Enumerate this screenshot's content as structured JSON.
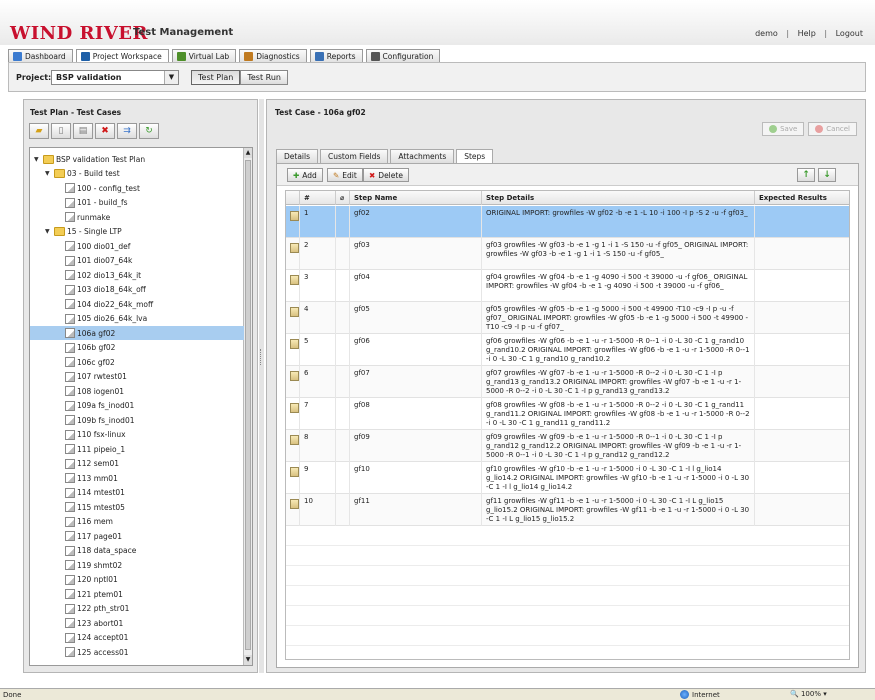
{
  "header": {
    "logo": "WIND RIVER",
    "app_title": "Test Management",
    "user": "demo",
    "help": "Help",
    "logout": "Logout"
  },
  "nav_tabs": [
    {
      "label": "Dashboard",
      "icon": "dashboard-icon",
      "color": "#3b7bd0"
    },
    {
      "label": "Project Workspace",
      "icon": "workspace-icon",
      "color": "#1d5fa8"
    },
    {
      "label": "Virtual Lab",
      "icon": "virtual-lab-icon",
      "color": "#4e8f2a"
    },
    {
      "label": "Diagnostics",
      "icon": "diagnostics-icon",
      "color": "#c07a20"
    },
    {
      "label": "Reports",
      "icon": "reports-icon",
      "color": "#3970b5"
    },
    {
      "label": "Configuration",
      "icon": "configuration-icon",
      "color": "#555555"
    }
  ],
  "project": {
    "label": "Project:",
    "selected": "BSP validation",
    "views": [
      "Test Plan",
      "Test Run"
    ]
  },
  "left_panel": {
    "title": "Test Plan - Test Cases",
    "tree": [
      {
        "label": "BSP validation Test Plan",
        "type": "folder",
        "level": 0,
        "open": true
      },
      {
        "label": "03 - Build test",
        "type": "folder",
        "level": 1,
        "open": true
      },
      {
        "label": "100 - config_test",
        "type": "doc",
        "level": 2
      },
      {
        "label": "101 - build_fs",
        "type": "doc",
        "level": 2
      },
      {
        "label": "runmake",
        "type": "doc",
        "level": 2
      },
      {
        "label": "15 - Single LTP",
        "type": "folder",
        "level": 1,
        "open": true
      },
      {
        "label": "100 dio01_def",
        "type": "doc",
        "level": 2
      },
      {
        "label": "101 dio07_64k",
        "type": "doc",
        "level": 2
      },
      {
        "label": "102 dio13_64k_it",
        "type": "doc",
        "level": 2
      },
      {
        "label": "103 dio18_64k_off",
        "type": "doc",
        "level": 2
      },
      {
        "label": "104 dio22_64k_moff",
        "type": "doc",
        "level": 2
      },
      {
        "label": "105 dio26_64k_lva",
        "type": "doc",
        "level": 2
      },
      {
        "label": "106a gf02",
        "type": "doc",
        "level": 2,
        "selected": true
      },
      {
        "label": "106b gf02",
        "type": "doc",
        "level": 2
      },
      {
        "label": "106c gf02",
        "type": "doc",
        "level": 2
      },
      {
        "label": "107 rwtest01",
        "type": "doc",
        "level": 2
      },
      {
        "label": "108 iogen01",
        "type": "doc",
        "level": 2
      },
      {
        "label": "109a fs_inod01",
        "type": "doc",
        "level": 2
      },
      {
        "label": "109b fs_inod01",
        "type": "doc",
        "level": 2
      },
      {
        "label": "110 fsx-linux",
        "type": "doc",
        "level": 2
      },
      {
        "label": "111 pipeio_1",
        "type": "doc",
        "level": 2
      },
      {
        "label": "112 sem01",
        "type": "doc",
        "level": 2
      },
      {
        "label": "113 mm01",
        "type": "doc",
        "level": 2
      },
      {
        "label": "114 mtest01",
        "type": "doc",
        "level": 2
      },
      {
        "label": "115 mtest05",
        "type": "doc",
        "level": 2
      },
      {
        "label": "116 mem",
        "type": "doc",
        "level": 2
      },
      {
        "label": "117 page01",
        "type": "doc",
        "level": 2
      },
      {
        "label": "118 data_space",
        "type": "doc",
        "level": 2
      },
      {
        "label": "119 shmt02",
        "type": "doc",
        "level": 2
      },
      {
        "label": "120 nptl01",
        "type": "doc",
        "level": 2
      },
      {
        "label": "121 ptem01",
        "type": "doc",
        "level": 2
      },
      {
        "label": "122 pth_str01",
        "type": "doc",
        "level": 2
      },
      {
        "label": "123 abort01",
        "type": "doc",
        "level": 2
      },
      {
        "label": "124 accept01",
        "type": "doc",
        "level": 2
      },
      {
        "label": "125 access01",
        "type": "doc",
        "level": 2
      }
    ]
  },
  "right_panel": {
    "title": "Test Case - 106a gf02",
    "save_label": "Save",
    "cancel_label": "Cancel",
    "tabs": [
      "Details",
      "Custom Fields",
      "Attachments",
      "Steps"
    ],
    "active_tab": "Steps",
    "toolbar": {
      "add": "Add",
      "edit": "Edit",
      "delete": "Delete"
    },
    "columns": [
      "#",
      "Step Name",
      "Step Details",
      "Expected Results"
    ],
    "steps": [
      {
        "num": "1",
        "name": "gf02",
        "details": "ORIGINAL IMPORT: growfiles -W gf02 -b -e 1 -L 10 -i 100 -I p -S 2 -u -f gf03_",
        "expected": ""
      },
      {
        "num": "2",
        "name": "gf03",
        "details": "gf03 growfiles -W gf03 -b -e 1 -g 1 -i 1 -S 150 -u -f gf05_ ORIGINAL IMPORT: growfiles -W gf03 -b -e 1 -g 1 -i 1 -S 150 -u -f gf05_",
        "expected": ""
      },
      {
        "num": "3",
        "name": "gf04",
        "details": "gf04 growfiles -W gf04 -b -e 1 -g 4090 -i 500 -t 39000 -u -f gf06_ ORIGINAL IMPORT: growfiles -W gf04 -b -e 1 -g 4090 -i 500 -t 39000 -u -f gf06_",
        "expected": ""
      },
      {
        "num": "4",
        "name": "gf05",
        "details": "gf05 growfiles -W gf05 -b -e 1 -g 5000 -i 500 -t 49900 -T10 -c9 -I p -u -f gf07_ ORIGINAL IMPORT: growfiles -W gf05 -b -e 1 -g 5000 -i 500 -t 49900 -T10 -c9 -I p -u -f gf07_",
        "expected": ""
      },
      {
        "num": "5",
        "name": "gf06",
        "details": "gf06 growfiles -W gf06 -b -e 1 -u -r 1-5000 -R 0--1 -i 0 -L 30 -C 1 g_rand10 g_rand10.2 ORIGINAL IMPORT: growfiles -W gf06 -b -e 1 -u -r 1-5000 -R 0--1 -i 0 -L 30 -C 1 g_rand10 g_rand10.2",
        "expected": ""
      },
      {
        "num": "6",
        "name": "gf07",
        "details": "gf07 growfiles -W gf07 -b -e 1 -u -r 1-5000 -R 0--2 -i 0 -L 30 -C 1 -I p g_rand13 g_rand13.2 ORIGINAL IMPORT: growfiles -W gf07 -b -e 1 -u -r 1-5000 -R 0--2 -i 0 -L 30 -C 1 -I p g_rand13 g_rand13.2",
        "expected": ""
      },
      {
        "num": "7",
        "name": "gf08",
        "details": "gf08 growfiles -W gf08 -b -e 1 -u -r 1-5000 -R 0--2 -i 0 -L 30 -C 1 g_rand11 g_rand11.2 ORIGINAL IMPORT: growfiles -W gf08 -b -e 1 -u -r 1-5000 -R 0--2 -i 0 -L 30 -C 1 g_rand11 g_rand11.2",
        "expected": ""
      },
      {
        "num": "8",
        "name": "gf09",
        "details": "gf09 growfiles -W gf09 -b -e 1 -u -r 1-5000 -R 0--1 -i 0 -L 30 -C 1 -I p g_rand12 g_rand12.2 ORIGINAL IMPORT: growfiles -W gf09 -b -e 1 -u -r 1-5000 -R 0--1 -i 0 -L 30 -C 1 -I p g_rand12 g_rand12.2",
        "expected": ""
      },
      {
        "num": "9",
        "name": "gf10",
        "details": "gf10 growfiles -W gf10 -b -e 1 -u -r 1-5000 -i 0 -L 30 -C 1 -I l g_lio14 g_lio14.2 ORIGINAL IMPORT: growfiles -W gf10 -b -e 1 -u -r 1-5000 -i 0 -L 30 -C 1 -I l g_lio14 g_lio14.2",
        "expected": ""
      },
      {
        "num": "10",
        "name": "gf11",
        "details": "gf11 growfiles -W gf11 -b -e 1 -u -r 1-5000 -i 0 -L 30 -C 1 -I L g_lio15 g_lio15.2 ORIGINAL IMPORT: growfiles -W gf11 -b -e 1 -u -r 1-5000 -i 0 -L 30 -C 1 -I L g_lio15 g_lio15.2",
        "expected": ""
      }
    ]
  },
  "status": {
    "left": "Done",
    "zone": "Internet",
    "zoom": "100%"
  },
  "colors": {
    "brand": "#c8102e",
    "selection": "#9dcaf5",
    "tree_selection": "#a8cdf0"
  }
}
